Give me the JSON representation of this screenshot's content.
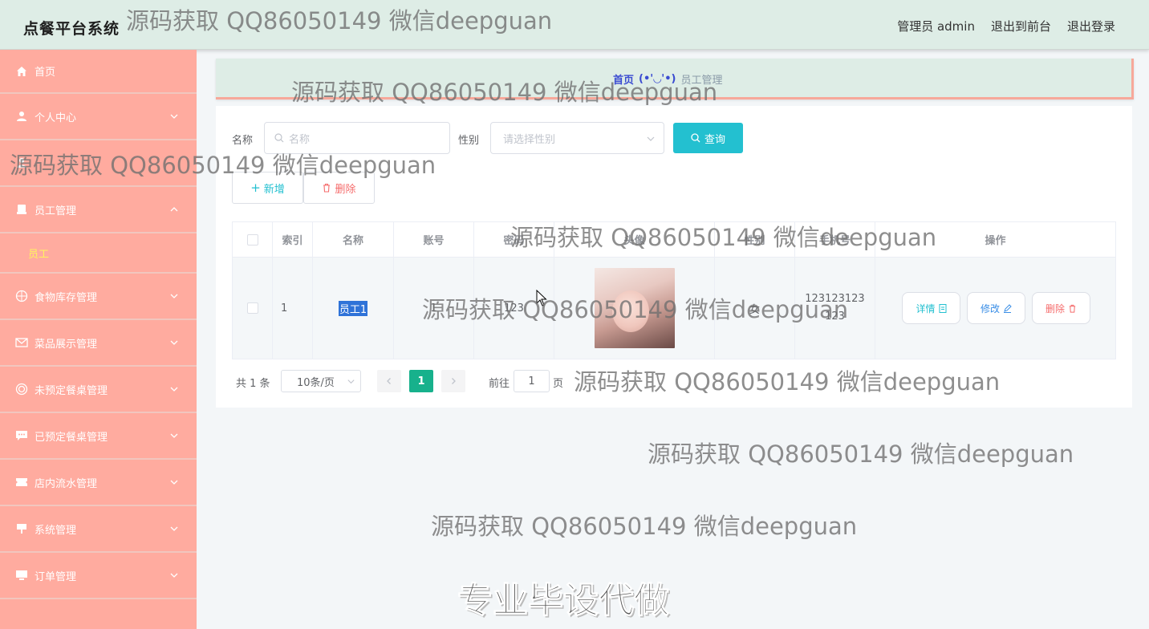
{
  "header": {
    "brand": "点餐平台系统",
    "admin_label": "管理员 admin",
    "to_front_label": "退出到前台",
    "logout_label": "退出登录"
  },
  "sidebar": {
    "items": [
      {
        "label": "首页",
        "icon": "home-icon"
      },
      {
        "label": "个人中心",
        "icon": "user-icon"
      },
      {
        "label": "",
        "icon": "user-icon"
      },
      {
        "label": "员工管理",
        "icon": "desktop-icon"
      },
      {
        "label": "食物库存管理",
        "icon": "target-icon"
      },
      {
        "label": "菜品展示管理",
        "icon": "mail-icon"
      },
      {
        "label": "未预定餐桌管理",
        "icon": "circle-icon"
      },
      {
        "label": "已预定餐桌管理",
        "icon": "chat-icon"
      },
      {
        "label": "店内流水管理",
        "icon": "ticket-icon"
      },
      {
        "label": "系统管理",
        "icon": "sign-icon"
      },
      {
        "label": "订单管理",
        "icon": "monitor-icon"
      }
    ],
    "submenu_label": "员工"
  },
  "breadcrumb": {
    "home": "首页",
    "separator": "(•'◡'•)",
    "current": "员工管理"
  },
  "search": {
    "name_label": "名称",
    "name_placeholder": "名称",
    "gender_label": "性别",
    "gender_placeholder": "请选择性别",
    "query_label": "查询"
  },
  "actions": {
    "add_label": "新增",
    "delete_label": "删除"
  },
  "table": {
    "columns": [
      "索引",
      "名称",
      "账号",
      "密码",
      "头像",
      "性别",
      "手机号",
      "操作"
    ],
    "rows": [
      {
        "index": "1",
        "name": "员工1",
        "account": "1",
        "password": "123",
        "gender": "女",
        "phone_line1": "123123123",
        "phone_line2": "123"
      }
    ],
    "row_actions": {
      "detail": "详情",
      "edit": "修改",
      "delete": "删除"
    }
  },
  "pagination": {
    "total_text": "共 1 条",
    "page_size": "10条/页",
    "current_page": "1",
    "goto_label": "前往",
    "goto_value": "1",
    "page_unit": "页"
  },
  "watermark": {
    "text": "源码获取 QQ86050149 微信deepguan",
    "big_text": "专业毕设代做"
  },
  "colors": {
    "header_bg": "#deede6",
    "sidebar_bg": "#ffab9f",
    "submenu_text": "#fff45f",
    "query_button": "#23c0d0",
    "active_page": "#17b18c",
    "detail_text": "#23c0d0",
    "edit_text": "#3a8ee6",
    "delete_text": "#f56c6c"
  }
}
